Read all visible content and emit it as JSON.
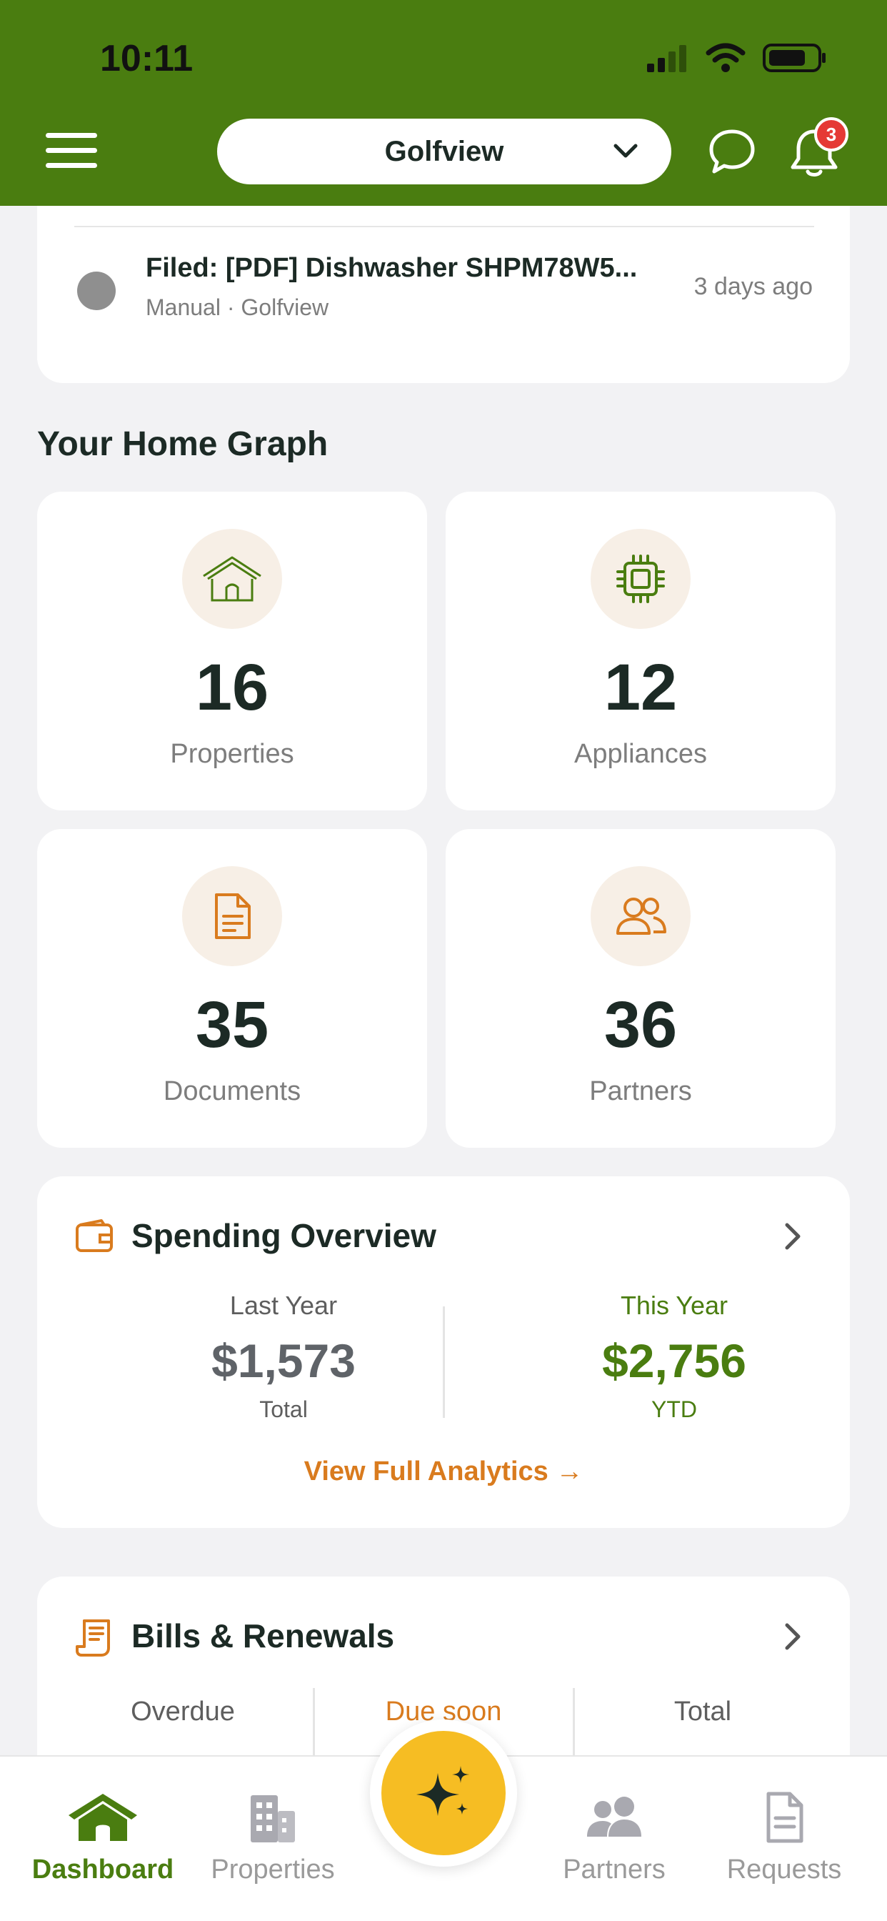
{
  "status_bar": {
    "time": "10:11"
  },
  "header": {
    "property_name": "Golfview",
    "notification_count": "3"
  },
  "recent_activity": {
    "title": "Filed: [PDF] Dishwasher SHPM78W5...",
    "subtitle": "Manual · Golfview",
    "time": "3 days ago"
  },
  "home_graph": {
    "title": "Your Home Graph",
    "stats": [
      {
        "value": "16",
        "label": "Properties",
        "icon": "house-icon"
      },
      {
        "value": "12",
        "label": "Appliances",
        "icon": "chip-icon"
      },
      {
        "value": "35",
        "label": "Documents",
        "icon": "document-icon"
      },
      {
        "value": "36",
        "label": "Partners",
        "icon": "people-icon"
      }
    ]
  },
  "spending": {
    "title": "Spending Overview",
    "last_year": {
      "label": "Last Year",
      "amount": "$1,573",
      "sub": "Total"
    },
    "this_year": {
      "label": "This Year",
      "amount": "$2,756",
      "sub": "YTD"
    },
    "link": "View Full Analytics →"
  },
  "bills": {
    "title": "Bills & Renewals",
    "columns": [
      "Overdue",
      "Due soon",
      "Total"
    ]
  },
  "nav": {
    "items": [
      "Dashboard",
      "Properties",
      "Partners",
      "Requests"
    ]
  },
  "colors": {
    "brand_green": "#4a7d10",
    "accent_orange": "#d97b1e",
    "fab_yellow": "#f6bd23",
    "badge_red": "#e53935"
  }
}
